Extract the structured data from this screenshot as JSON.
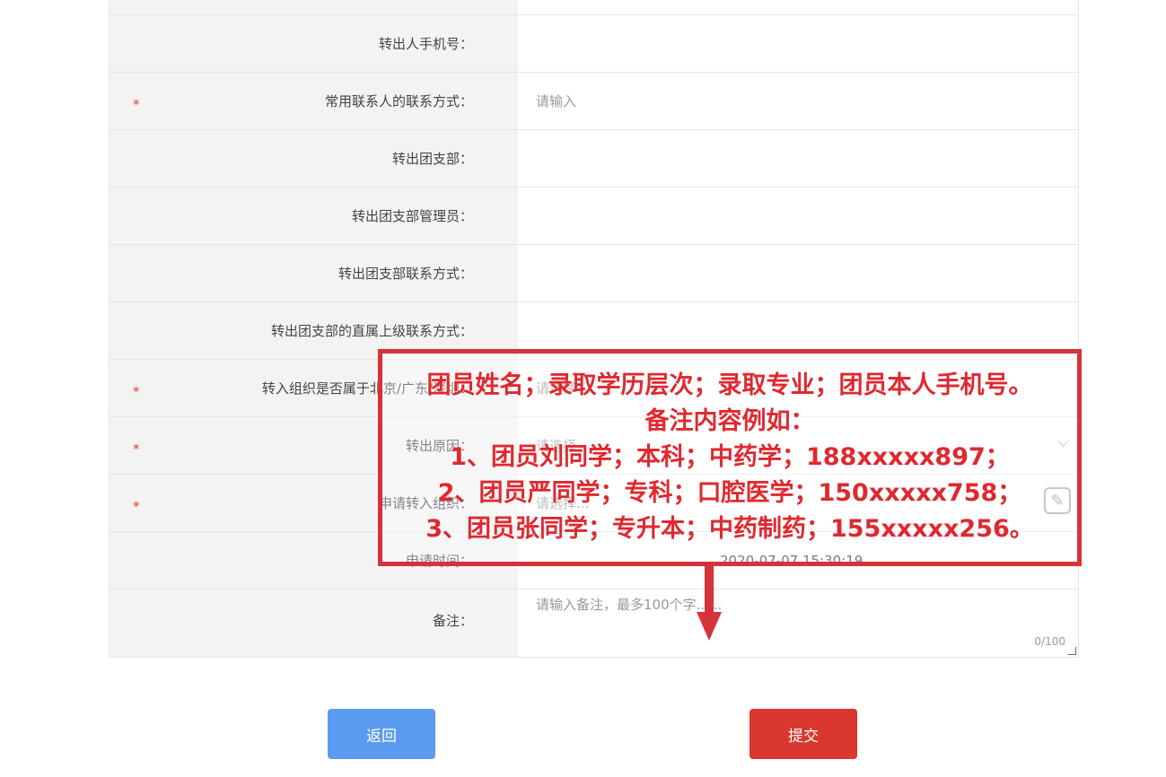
{
  "form": {
    "rows": [
      {
        "label": "",
        "value": ""
      },
      {
        "label": "转出人手机号：",
        "value": ""
      },
      {
        "label": "常用联系人的联系方式：",
        "value": "",
        "placeholder": "请输入",
        "required": true
      },
      {
        "label": "转出团支部：",
        "value": ""
      },
      {
        "label": "转出团支部管理员：",
        "value": ""
      },
      {
        "label": "转出团支部联系方式：",
        "value": ""
      },
      {
        "label": "转出团支部的直属上级联系方式：",
        "value": ""
      },
      {
        "label": "转入组织是否属于北京/广东/深圳：",
        "value": "",
        "placeholder": "请选择",
        "required": true
      },
      {
        "label": "转出原因：",
        "value": "",
        "placeholder": "请选择",
        "required": true
      },
      {
        "label": "申请转入组织：",
        "value": "",
        "placeholder": "请选择...",
        "required": true
      },
      {
        "label": "申请时间：",
        "value": "2020-07-07 15:30:19"
      },
      {
        "label": "备注：",
        "value": "",
        "placeholder": "请输入备注，最多100个字......",
        "counter": "0/100"
      }
    ],
    "required_mark": "*"
  },
  "buttons": {
    "back": "返回",
    "submit": "提交"
  },
  "annotation": {
    "lines": [
      "团员姓名；录取学历层次；录取专业；团员本人手机号。",
      "备注内容例如：",
      "1、团员刘同学；本科；中药学；188xxxxx897；",
      "2、团员严同学；专科；口腔医学；150xxxxx758；",
      "3、团员张同学；专升本；中药制药；155xxxxx256。"
    ],
    "color": "#d6323a"
  },
  "icons": {
    "select": "chevron-down-icon",
    "edit": "pencil-edit-icon"
  }
}
